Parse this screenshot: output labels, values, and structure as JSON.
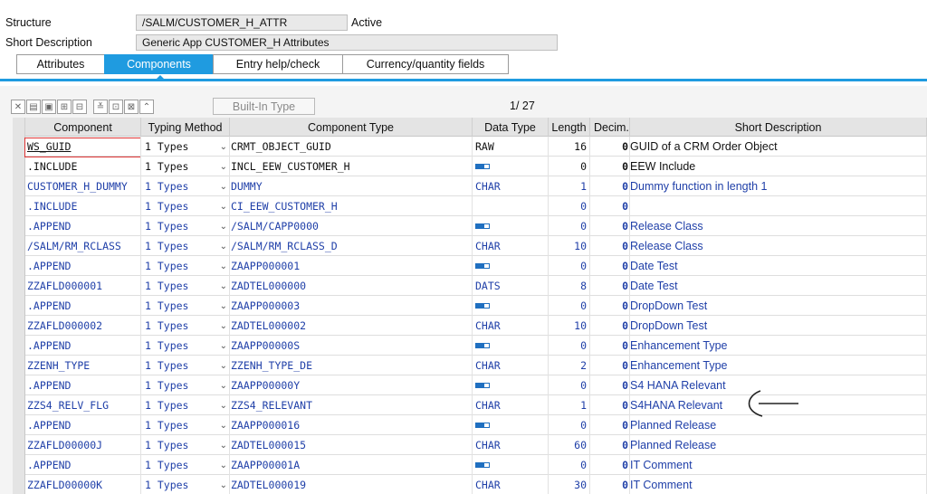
{
  "header": {
    "structure_label": "Structure",
    "structure_value": "/SALM/CUSTOMER_H_ATTR",
    "status": "Active",
    "short_desc_label": "Short Description",
    "short_desc_value": "Generic App CUSTOMER_H Attributes"
  },
  "tabs": [
    {
      "label": "Attributes",
      "active": false
    },
    {
      "label": "Components",
      "active": true
    },
    {
      "label": "Entry help/check",
      "active": false
    },
    {
      "label": "Currency/quantity fields",
      "active": false
    }
  ],
  "toolbar": {
    "builtin_label": "Built-In Type",
    "pager": "1/  27",
    "icons": [
      "cut-icon",
      "copy-icon",
      "paste-icon",
      "insert-row-icon",
      "delete-row-icon",
      "collapse-icon",
      "append-icon",
      "include-icon",
      "expand-icon"
    ]
  },
  "columns": {
    "component": "Component",
    "typing_method": "Typing Method",
    "component_type": "Component Type",
    "data_type": "Data Type",
    "length": "Length",
    "decimals": "Decim..",
    "short_description": "Short Description"
  },
  "rows": [
    {
      "component": "WS_GUID",
      "typing": "1 Types",
      "ctype": "CRMT_OBJECT_GUID",
      "dtype": "RAW",
      "length": "16",
      "dec": "0",
      "desc": "GUID of a CRM Order Object",
      "dark": true
    },
    {
      "component": ".INCLUDE",
      "typing": "1 Types",
      "ctype": "INCL_EEW_CUSTOMER_H",
      "dtype": "",
      "struct": true,
      "length": "0",
      "dec": "0",
      "desc": "EEW Include",
      "dark": true
    },
    {
      "component": "CUSTOMER_H_DUMMY",
      "typing": "1 Types",
      "ctype": "DUMMY",
      "dtype": "CHAR",
      "length": "1",
      "dec": "0",
      "desc": "Dummy function in length 1",
      "dark": false
    },
    {
      "component": ".INCLUDE",
      "typing": "1 Types",
      "ctype": "CI_EEW_CUSTOMER_H",
      "dtype": "",
      "length": "0",
      "dec": "0",
      "desc": "",
      "dark": false
    },
    {
      "component": ".APPEND",
      "typing": "1 Types",
      "ctype": "/SALM/CAPP0000",
      "dtype": "",
      "struct": true,
      "length": "0",
      "dec": "0",
      "desc": "Release Class",
      "dark": false
    },
    {
      "component": "/SALM/RM_RCLASS",
      "typing": "1 Types",
      "ctype": "/SALM/RM_RCLASS_D",
      "dtype": "CHAR",
      "length": "10",
      "dec": "0",
      "desc": "Release Class",
      "dark": false
    },
    {
      "component": ".APPEND",
      "typing": "1 Types",
      "ctype": "ZAAPP000001",
      "dtype": "",
      "struct": true,
      "length": "0",
      "dec": "0",
      "desc": "Date Test",
      "dark": false
    },
    {
      "component": "ZZAFLD000001",
      "typing": "1 Types",
      "ctype": "ZADTEL000000",
      "dtype": "DATS",
      "length": "8",
      "dec": "0",
      "desc": "Date Test",
      "dark": false
    },
    {
      "component": ".APPEND",
      "typing": "1 Types",
      "ctype": "ZAAPP000003",
      "dtype": "",
      "struct": true,
      "length": "0",
      "dec": "0",
      "desc": "DropDown Test",
      "dark": false
    },
    {
      "component": "ZZAFLD000002",
      "typing": "1 Types",
      "ctype": "ZADTEL000002",
      "dtype": "CHAR",
      "length": "10",
      "dec": "0",
      "desc": "DropDown Test",
      "dark": false
    },
    {
      "component": ".APPEND",
      "typing": "1 Types",
      "ctype": "ZAAPP00000S",
      "dtype": "",
      "struct": true,
      "length": "0",
      "dec": "0",
      "desc": "Enhancement Type",
      "dark": false
    },
    {
      "component": "ZZENH_TYPE",
      "typing": "1 Types",
      "ctype": "ZZENH_TYPE_DE",
      "dtype": "CHAR",
      "length": "2",
      "dec": "0",
      "desc": "Enhancement Type",
      "dark": false
    },
    {
      "component": ".APPEND",
      "typing": "1 Types",
      "ctype": "ZAAPP00000Y",
      "dtype": "",
      "struct": true,
      "length": "0",
      "dec": "0",
      "desc": "S4 HANA Relevant",
      "dark": false
    },
    {
      "component": "ZZS4_RELV_FLG",
      "typing": "1 Types",
      "ctype": "ZZS4_RELEVANT",
      "dtype": "CHAR",
      "length": "1",
      "dec": "0",
      "desc": "S4HANA Relevant",
      "dark": false
    },
    {
      "component": ".APPEND",
      "typing": "1 Types",
      "ctype": "ZAAPP000016",
      "dtype": "",
      "struct": true,
      "length": "0",
      "dec": "0",
      "desc": "Planned Release",
      "dark": false
    },
    {
      "component": "ZZAFLD00000J",
      "typing": "1 Types",
      "ctype": "ZADTEL000015",
      "dtype": "CHAR",
      "length": "60",
      "dec": "0",
      "desc": "Planned Release",
      "dark": false
    },
    {
      "component": ".APPEND",
      "typing": "1 Types",
      "ctype": "ZAAPP00001A",
      "dtype": "",
      "struct": true,
      "length": "0",
      "dec": "0",
      "desc": "IT Comment",
      "dark": false
    },
    {
      "component": "ZZAFLD00000K",
      "typing": "1 Types",
      "ctype": "ZADTEL000019",
      "dtype": "CHAR",
      "length": "30",
      "dec": "0",
      "desc": "IT Comment",
      "dark": false
    }
  ],
  "colors": {
    "accent": "#1f9be0",
    "link_text": "#1f3fa8",
    "header_bg": "#e4e4e4"
  }
}
